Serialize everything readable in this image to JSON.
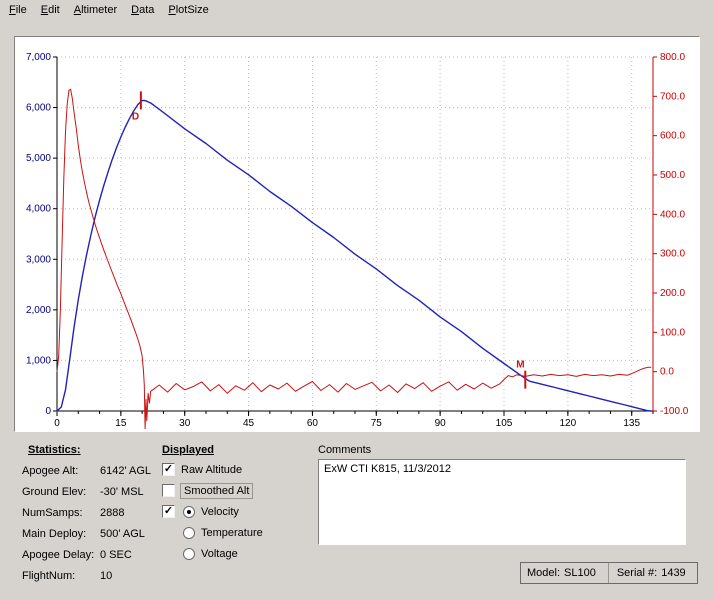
{
  "menu": {
    "items": [
      {
        "label": "File"
      },
      {
        "label": "Edit"
      },
      {
        "label": "Altimeter"
      },
      {
        "label": "Data"
      },
      {
        "label": "PlotSize"
      }
    ]
  },
  "chart_data": {
    "type": "line",
    "title": "",
    "grid": true,
    "x_axis": {
      "min": 0,
      "max": 140,
      "major_ticks": [
        0,
        15,
        30,
        45,
        60,
        75,
        90,
        105,
        120,
        135
      ],
      "minor_step": 5
    },
    "left_axis": {
      "label_color": "#000080",
      "axis_color": "#000000",
      "min": 0,
      "max": 7000,
      "step": 1000,
      "tick_labels": [
        "0",
        "1,000",
        "2,000",
        "3,000",
        "4,000",
        "5,000",
        "6,000",
        "7,000"
      ]
    },
    "right_axis": {
      "color": "#cc0000",
      "min": -100,
      "max": 800,
      "step": 100,
      "tick_labels": [
        "-100.0",
        "0.0",
        "100.0",
        "200.0",
        "300.0",
        "400.0",
        "500.0",
        "600.0",
        "700.0",
        "800.0"
      ]
    },
    "series": [
      {
        "name": "Raw Altitude",
        "axis": "left",
        "color": "#2222bb",
        "width": 1.4,
        "points": [
          [
            0,
            0
          ],
          [
            1,
            80
          ],
          [
            2,
            420
          ],
          [
            3,
            1030
          ],
          [
            4,
            1650
          ],
          [
            5,
            2200
          ],
          [
            6,
            2680
          ],
          [
            7,
            3110
          ],
          [
            8,
            3500
          ],
          [
            9,
            3850
          ],
          [
            10,
            4170
          ],
          [
            11,
            4460
          ],
          [
            12,
            4730
          ],
          [
            13,
            4980
          ],
          [
            14,
            5210
          ],
          [
            15,
            5420
          ],
          [
            16,
            5610
          ],
          [
            17,
            5780
          ],
          [
            18,
            5930
          ],
          [
            19,
            6060
          ],
          [
            20,
            6140
          ],
          [
            20.5,
            6142
          ],
          [
            21,
            6128
          ],
          [
            22,
            6090
          ],
          [
            23,
            6030
          ],
          [
            25,
            5905
          ],
          [
            30,
            5580
          ],
          [
            35,
            5290
          ],
          [
            40,
            4960
          ],
          [
            45,
            4670
          ],
          [
            50,
            4340
          ],
          [
            55,
            4050
          ],
          [
            60,
            3725
          ],
          [
            65,
            3430
          ],
          [
            70,
            3100
          ],
          [
            75,
            2810
          ],
          [
            80,
            2480
          ],
          [
            85,
            2190
          ],
          [
            90,
            1860
          ],
          [
            95,
            1570
          ],
          [
            100,
            1240
          ],
          [
            105,
            940
          ],
          [
            107,
            820
          ],
          [
            109,
            700
          ],
          [
            110,
            645
          ],
          [
            111,
            590
          ],
          [
            113,
            548
          ],
          [
            115,
            506
          ],
          [
            117,
            464
          ],
          [
            119,
            422
          ],
          [
            121,
            380
          ],
          [
            123,
            338
          ],
          [
            125,
            296
          ],
          [
            127,
            254
          ],
          [
            129,
            212
          ],
          [
            131,
            170
          ],
          [
            133,
            128
          ],
          [
            135,
            86
          ],
          [
            137,
            44
          ],
          [
            138.5,
            12
          ],
          [
            139.5,
            0
          ]
        ]
      },
      {
        "name": "Velocity",
        "axis": "right",
        "color": "#cc1111",
        "width": 1,
        "points": [
          [
            0,
            0
          ],
          [
            0.4,
            40
          ],
          [
            0.8,
            160
          ],
          [
            1.2,
            330
          ],
          [
            1.6,
            490
          ],
          [
            2,
            610
          ],
          [
            2.4,
            680
          ],
          [
            2.8,
            715
          ],
          [
            3.2,
            718
          ],
          [
            3.6,
            695
          ],
          [
            4,
            660
          ],
          [
            4.5,
            620
          ],
          [
            5,
            575
          ],
          [
            5.5,
            538
          ],
          [
            6,
            506
          ],
          [
            6.5,
            478
          ],
          [
            7,
            453
          ],
          [
            7.5,
            430
          ],
          [
            8,
            410
          ],
          [
            8.5,
            391
          ],
          [
            9,
            373
          ],
          [
            9.5,
            356
          ],
          [
            10,
            340
          ],
          [
            10.5,
            324
          ],
          [
            11,
            309
          ],
          [
            11.5,
            294
          ],
          [
            12,
            280
          ],
          [
            12.5,
            266
          ],
          [
            13,
            252
          ],
          [
            13.5,
            238
          ],
          [
            14,
            224
          ],
          [
            14.5,
            211
          ],
          [
            15,
            198
          ],
          [
            15.5,
            184
          ],
          [
            16,
            170
          ],
          [
            16.5,
            156
          ],
          [
            17,
            142
          ],
          [
            17.5,
            128
          ],
          [
            18,
            113
          ],
          [
            18.5,
            98
          ],
          [
            19,
            82
          ],
          [
            19.5,
            65
          ],
          [
            20,
            40
          ],
          [
            20.3,
            5
          ],
          [
            20.5,
            -35
          ],
          [
            20.7,
            -145
          ],
          [
            20.9,
            -70
          ],
          [
            21.1,
            -125
          ],
          [
            21.4,
            -55
          ],
          [
            21.7,
            -80
          ],
          [
            22,
            -50
          ],
          [
            24,
            -34
          ],
          [
            26,
            -52
          ],
          [
            28,
            -30
          ],
          [
            30,
            -46
          ],
          [
            32,
            -38
          ],
          [
            34,
            -26
          ],
          [
            36,
            -49
          ],
          [
            38,
            -33
          ],
          [
            40,
            -55
          ],
          [
            42,
            -36
          ],
          [
            44,
            -47
          ],
          [
            46,
            -28
          ],
          [
            48,
            -51
          ],
          [
            50,
            -34
          ],
          [
            52,
            -44
          ],
          [
            54,
            -29
          ],
          [
            56,
            -50
          ],
          [
            58,
            -37
          ],
          [
            60,
            -25
          ],
          [
            62,
            -48
          ],
          [
            64,
            -33
          ],
          [
            66,
            -52
          ],
          [
            68,
            -30
          ],
          [
            70,
            -45
          ],
          [
            72,
            -36
          ],
          [
            74,
            -27
          ],
          [
            76,
            -49
          ],
          [
            78,
            -34
          ],
          [
            80,
            -53
          ],
          [
            82,
            -31
          ],
          [
            84,
            -43
          ],
          [
            86,
            -28
          ],
          [
            88,
            -50
          ],
          [
            90,
            -37
          ],
          [
            92,
            -26
          ],
          [
            94,
            -47
          ],
          [
            96,
            -32
          ],
          [
            98,
            -44
          ],
          [
            100,
            -29
          ],
          [
            102,
            -42
          ],
          [
            104,
            -31
          ],
          [
            105,
            -20
          ],
          [
            106,
            -10
          ],
          [
            107,
            -13
          ],
          [
            108,
            -8
          ],
          [
            110,
            -12
          ],
          [
            112,
            -8
          ],
          [
            114,
            -11
          ],
          [
            116,
            -7
          ],
          [
            118,
            -10
          ],
          [
            120,
            -8
          ],
          [
            122,
            -12
          ],
          [
            124,
            -7
          ],
          [
            126,
            -10
          ],
          [
            128,
            -8
          ],
          [
            130,
            -11
          ],
          [
            132,
            -7
          ],
          [
            134,
            -9
          ],
          [
            135,
            -5
          ],
          [
            136,
            0
          ],
          [
            137,
            5
          ],
          [
            138,
            9
          ],
          [
            139,
            11
          ],
          [
            139.5,
            11
          ]
        ]
      }
    ],
    "markers": [
      {
        "label": "D",
        "t": 19.7,
        "value": 6142,
        "axis": "left",
        "label_pos": "below",
        "color": "#cc1111"
      },
      {
        "label": "M",
        "t": 110,
        "value": 620,
        "axis": "left",
        "label_pos": "above",
        "color": "#cc1111"
      }
    ]
  },
  "stats": {
    "heading": "Statistics:",
    "rows": [
      {
        "label": "Apogee Alt:",
        "value": "6142' AGL"
      },
      {
        "label": "Ground Elev:",
        "value": "-30' MSL"
      },
      {
        "label": "NumSamps:",
        "value": "2888"
      },
      {
        "label": "Main Deploy:",
        "value": "500' AGL"
      },
      {
        "label": "Apogee Delay:",
        "value": "0 SEC"
      },
      {
        "label": "FlightNum:",
        "value": "10"
      }
    ]
  },
  "displayed": {
    "heading": "Displayed",
    "raw_altitude": {
      "label": "Raw Altitude",
      "checked": true
    },
    "smoothed_alt": {
      "label": "Smoothed Alt",
      "checked": false
    },
    "velocity": {
      "label": "Velocity",
      "checked": true,
      "selected": true
    },
    "temperature": {
      "label": "Temperature",
      "selected": false
    },
    "voltage": {
      "label": "Voltage",
      "selected": false
    }
  },
  "comments": {
    "title": "Comments",
    "text": "ExW CTI K815, 11/3/2012"
  },
  "model_box": {
    "model_label": "Model:",
    "model_value": "SL100",
    "serial_label": "Serial #:",
    "serial_value": "1439"
  }
}
